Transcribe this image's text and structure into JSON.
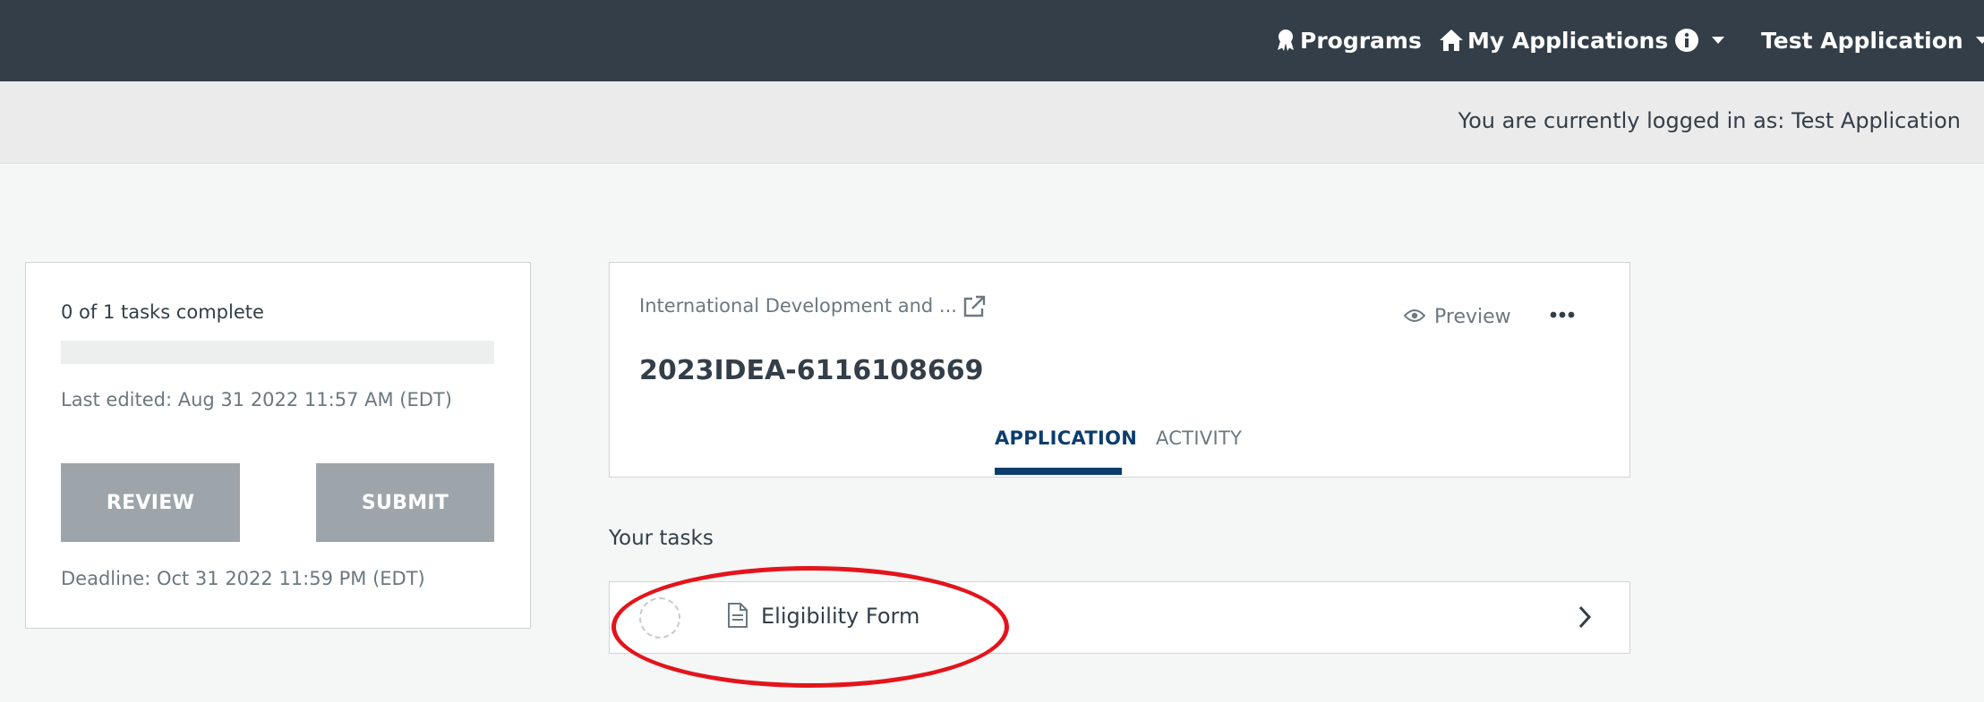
{
  "nav": {
    "programs": "Programs",
    "my_applications": "My Applications",
    "user": "Test Application"
  },
  "login_bar": {
    "text": "You are currently logged in as: Test Application"
  },
  "summary": {
    "tasks_complete": "0 of 1 tasks complete",
    "progress_fraction": 0,
    "last_edited": "Last edited: Aug 31 2022 11:57 AM (EDT)",
    "review_label": "REVIEW",
    "submit_label": "SUBMIT",
    "deadline": "Deadline: Oct 31 2022 11:59 PM (EDT)"
  },
  "application": {
    "program_name": "International Development and ...",
    "app_id": "2023IDEA-6116108669",
    "preview_label": "Preview",
    "tabs": [
      {
        "label": "APPLICATION",
        "active": true
      },
      {
        "label": "ACTIVITY",
        "active": false
      }
    ]
  },
  "tasks": {
    "heading": "Your tasks",
    "items": [
      {
        "label": "Eligibility Form",
        "status": "not started"
      }
    ]
  },
  "colors": {
    "nav_bg": "#333e48",
    "accent": "#0b3d6e",
    "button_disabled": "#9da5aa",
    "annotation": "#e3141b"
  },
  "icons": [
    "programs-ribbon-icon",
    "home-icon",
    "info-icon",
    "external-link-icon",
    "eye-icon",
    "more-dots-icon",
    "document-icon",
    "chevron-right-icon"
  ]
}
